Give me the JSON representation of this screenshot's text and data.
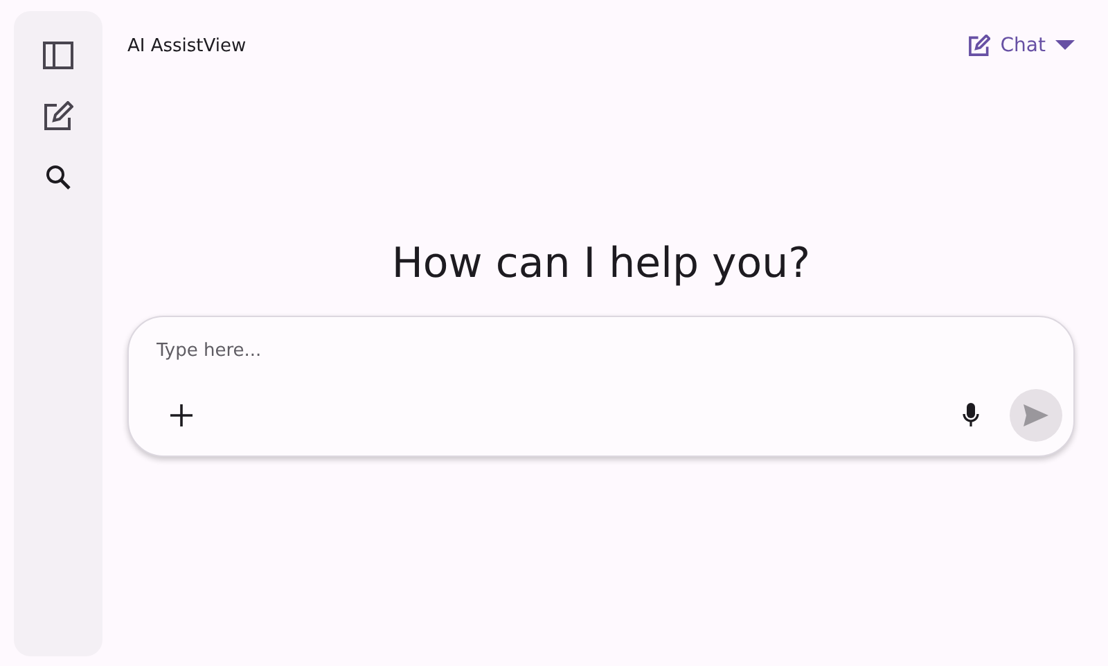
{
  "header": {
    "title": "AI AssistView",
    "mode": "Chat"
  },
  "greeting": "How can I help you?",
  "composer": {
    "placeholder": "Type here...",
    "send_disabled": true
  }
}
